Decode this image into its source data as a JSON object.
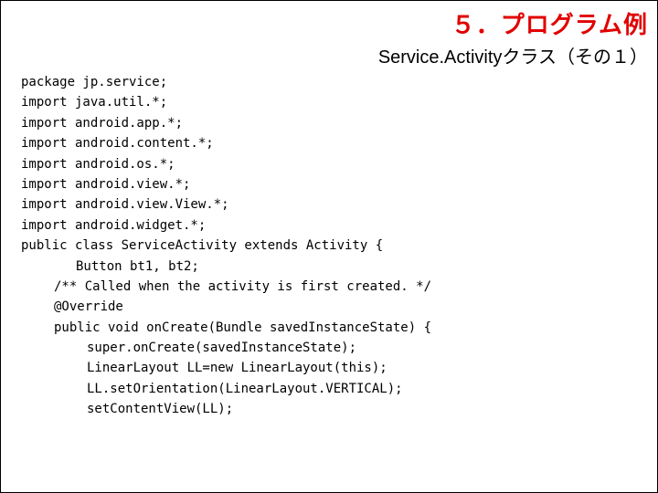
{
  "header": {
    "title_main": "５．プログラム例",
    "title_sub": "Service.Activityクラス（その１）"
  },
  "code": {
    "lines": [
      {
        "cls": "",
        "text": "package jp.service;"
      },
      {
        "cls": "",
        "text": "import java.util.*;"
      },
      {
        "cls": "",
        "text": "import android.app.*;"
      },
      {
        "cls": "",
        "text": "import android.content.*;"
      },
      {
        "cls": "",
        "text": "import android.os.*;"
      },
      {
        "cls": "",
        "text": "import android.view.*;"
      },
      {
        "cls": "",
        "text": "import android.view.View.*;"
      },
      {
        "cls": "",
        "text": "import android.widget.*;"
      },
      {
        "cls": "",
        "text": "public class ServiceActivity extends Activity {"
      },
      {
        "cls": "indent1",
        "text": "Button bt1, bt2;"
      },
      {
        "cls": "indent2",
        "text": "/** Called when the activity is first created. */"
      },
      {
        "cls": "indent2",
        "text": "@Override"
      },
      {
        "cls": "indent2",
        "text": "public void onCreate(Bundle savedInstanceState) {"
      },
      {
        "cls": "indent3",
        "text": "super.onCreate(savedInstanceState);"
      },
      {
        "cls": "indent3",
        "text": "LinearLayout LL=new LinearLayout(this);"
      },
      {
        "cls": "indent3",
        "text": "LL.setOrientation(LinearLayout.VERTICAL);"
      },
      {
        "cls": "indent3",
        "text": "setContentView(LL);"
      }
    ]
  }
}
